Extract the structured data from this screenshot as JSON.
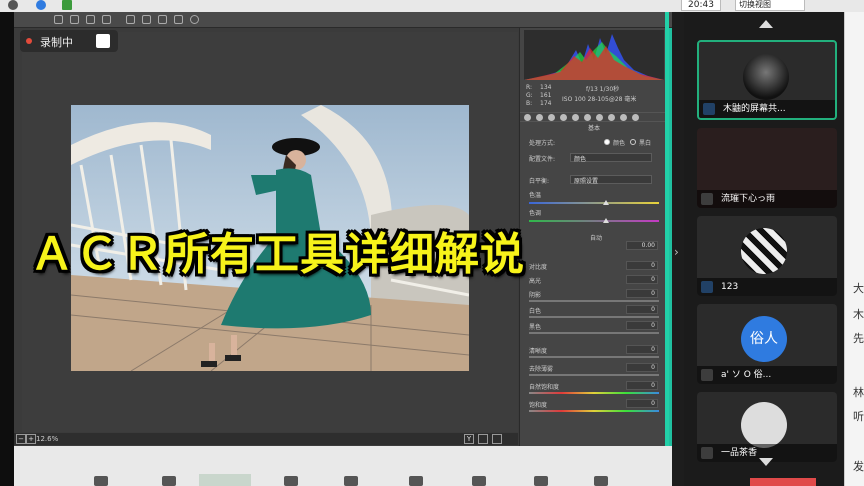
{
  "topbar": {
    "time": "20:43",
    "switch_view": "切换视图"
  },
  "recording": {
    "label": "录制中"
  },
  "headline": "ＡＣＲ所有工具详细解说",
  "ps": {
    "zoom": "12.6%",
    "panel": {
      "rgb_labels": [
        "R:",
        "G:",
        "B:"
      ],
      "rgb_values": [
        "134",
        "161",
        "174"
      ],
      "meta_top": "f/13   1/30秒",
      "meta_bottom": "ISO 100   28-105@28 毫米",
      "section_title": "基本",
      "treatment_label": "处理方式:",
      "treatment_color": "颜色",
      "treatment_bw": "黑白",
      "profile_label": "配置文件:",
      "profile_value": "颜色",
      "wb_label": "白平衡:",
      "wb_value": "原照设置",
      "temp_label": "色温",
      "tint_label": "色调",
      "auto_label": "自动",
      "exposure_value": "0.00",
      "rows": [
        {
          "label": "对比度",
          "value": "0"
        },
        {
          "label": "高光",
          "value": "0"
        },
        {
          "label": "阴影",
          "value": "0"
        },
        {
          "label": "白色",
          "value": "0"
        },
        {
          "label": "黑色",
          "value": "0"
        },
        {
          "label": "清晰度",
          "value": "0"
        },
        {
          "label": "去除薄雾",
          "value": "0"
        },
        {
          "label": "自然饱和度",
          "value": "0"
        },
        {
          "label": "饱和度",
          "value": "0"
        }
      ]
    }
  },
  "participants": [
    {
      "name": "木鼬的屏幕共...",
      "selected": true
    },
    {
      "name": "流璀下心っ雨",
      "selected": false
    },
    {
      "name": "123",
      "selected": false
    },
    {
      "name": "a' ソ O 俗...",
      "avatar_text": "俗人",
      "selected": false
    },
    {
      "name": "一品茶香",
      "selected": false
    }
  ],
  "chat_fragments": [
    "大",
    "木",
    "先",
    "林",
    "听",
    "发"
  ],
  "colors": {
    "accent_green": "#22b07d",
    "headline_yellow": "#f7f31a",
    "record_red": "#e34b3b"
  }
}
